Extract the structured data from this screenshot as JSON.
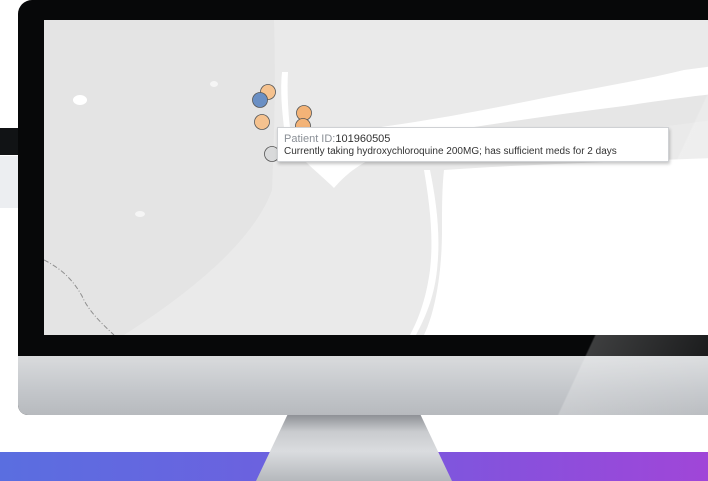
{
  "map": {
    "markers": [
      {
        "label": "orange",
        "color": "#f5c28f"
      },
      {
        "label": "blue",
        "color": "#6a8fc4"
      },
      {
        "label": "orange",
        "color": "#f5c28f"
      },
      {
        "label": "orange",
        "color": "#f3b377"
      },
      {
        "label": "orange",
        "color": "#f3b377"
      },
      {
        "label": "blue",
        "color": "#6a8fc4"
      },
      {
        "label": "grey",
        "color": "#d9dadb"
      }
    ]
  },
  "tooltip": {
    "patient_label": "Patient ID:",
    "patient_id": "101960505",
    "description": "Currently taking hydroxychloroquine 200MG; has sufficient meds for 2 days"
  },
  "colors": {
    "marker_orange": "#f5c28f",
    "marker_blue": "#6a8fc4",
    "bezel": "#070809",
    "footer_gradient_start": "#5a6ee0",
    "footer_gradient_end": "#a046d8"
  }
}
